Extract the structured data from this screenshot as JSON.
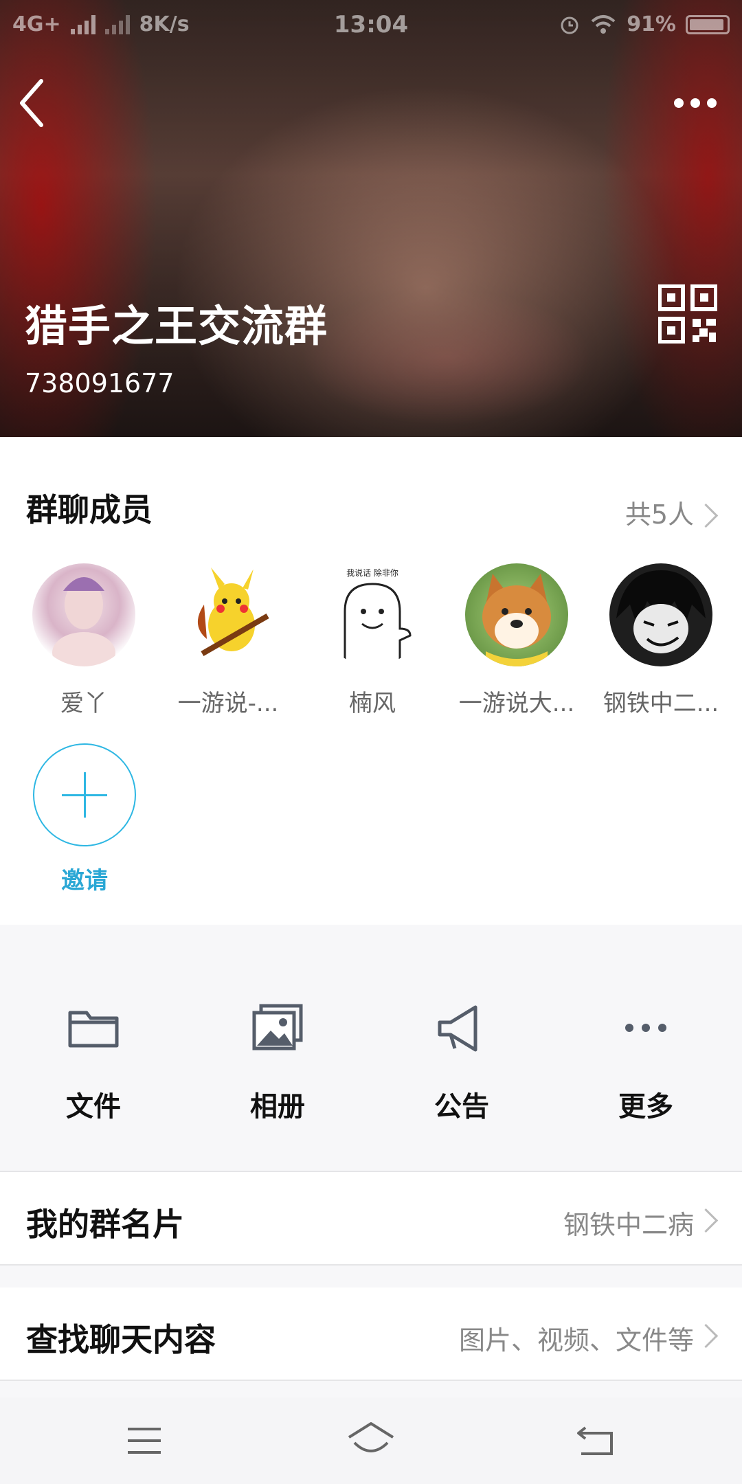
{
  "status_bar": {
    "network": "4G+",
    "speed": "8K/s",
    "time": "13:04",
    "battery": "91%"
  },
  "header": {
    "group_name": "猎手之王交流群",
    "group_id": "738091677"
  },
  "members": {
    "title": "群聊成员",
    "count": "共5人",
    "items": [
      {
        "name": "爱丫"
      },
      {
        "name": "一游说-..."
      },
      {
        "name": "楠风"
      },
      {
        "name": "一游说大..."
      },
      {
        "name": "钢铁中二..."
      }
    ],
    "invite_label": "邀请"
  },
  "actions": [
    {
      "label": "文件",
      "icon": "folder-icon"
    },
    {
      "label": "相册",
      "icon": "album-icon"
    },
    {
      "label": "公告",
      "icon": "megaphone-icon"
    },
    {
      "label": "更多",
      "icon": "more-dots-icon"
    }
  ],
  "rows": {
    "group_card": {
      "label": "我的群名片",
      "value": "钢铁中二病"
    },
    "search_chat": {
      "label": "查找聊天内容",
      "value": "图片、视频、文件等"
    }
  },
  "colors": {
    "accent": "#2eb7e3",
    "muted": "#888888"
  }
}
